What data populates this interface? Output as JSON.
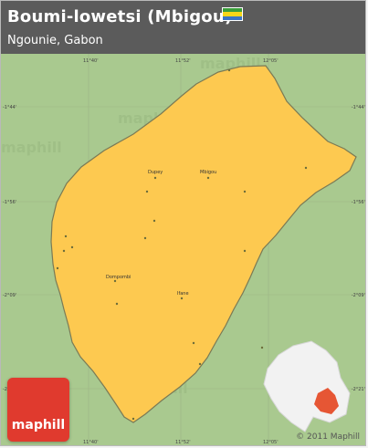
{
  "header": {
    "title": "Boumi-lowetsi (Mbigou)",
    "subtitle": "Ngounie, Gabon",
    "flag_colors": [
      "#3a9e3a",
      "#f7d618",
      "#3a75c4"
    ]
  },
  "map": {
    "colors": {
      "background": "#a9c98f",
      "region_fill": "#fdc950",
      "region_stroke": "#7a7a55",
      "grid": "#9db485",
      "place_dot": "#6d6d3a",
      "inset_land": "#f2f2f2",
      "inset_highlight": "#e65634"
    },
    "top_ticks": [
      "11°40'",
      "11°52'",
      "12°05'"
    ],
    "bottom_ticks": [
      "11°40'",
      "11°52'",
      "12°05'"
    ],
    "left_ticks": [
      "-1°44'",
      "-1°56'",
      "-2°09'",
      "-2°21'"
    ],
    "right_ticks": [
      "-1°44'",
      "-1°56'",
      "-2°09'",
      "-2°21'"
    ],
    "places": [
      {
        "name": "Dupey",
        "labeled": true
      },
      {
        "name": "Mbigou",
        "labeled": true
      },
      {
        "name": "Dompombi",
        "labeled": true
      },
      {
        "name": "Ifane",
        "labeled": true
      }
    ],
    "watermark": "maphill"
  },
  "footer": {
    "logo_text": "maphill",
    "copyright": "© 2011 Maphill"
  }
}
